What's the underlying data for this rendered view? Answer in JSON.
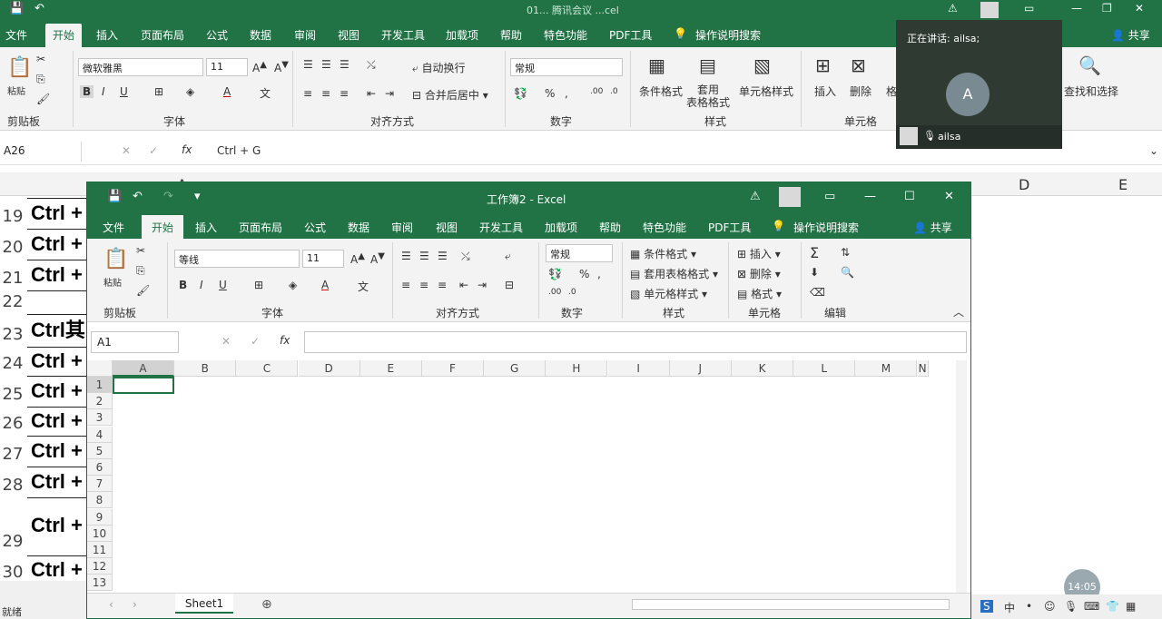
{
  "outer": {
    "title": "01... 腾讯会议 ...cel",
    "tabs": [
      "文件",
      "开始",
      "插入",
      "页面布局",
      "公式",
      "数据",
      "审阅",
      "视图",
      "开发工具",
      "加载项",
      "帮助",
      "特色功能",
      "PDF工具",
      "操作说明搜索"
    ],
    "share": "共享",
    "font_name": "微软雅黑",
    "font_size": "11",
    "number_format": "常规",
    "wrap_text": "自动换行",
    "merge_center": "合并后居中",
    "cond_format": "条件格式",
    "table_format": "套用\n表格格式",
    "cell_style": "单元格样式",
    "insert": "插入",
    "delete": "删除",
    "format_partial": "格",
    "find_select": "查找和选择",
    "paste": "粘贴",
    "groups": [
      "剪贴板",
      "字体",
      "对齐方式",
      "数字",
      "样式",
      "单元格"
    ],
    "namebox": "A26",
    "formula": "Ctrl + G",
    "columns": [
      "A",
      "D",
      "E"
    ],
    "rows": [
      {
        "n": "19",
        "text": "Ctrl +"
      },
      {
        "n": "20",
        "text": "Ctrl +"
      },
      {
        "n": "21",
        "text": "Ctrl +"
      },
      {
        "n": "22",
        "text": ""
      },
      {
        "n": "23",
        "text": "Ctrl其"
      },
      {
        "n": "24",
        "text": "Ctrl +"
      },
      {
        "n": "25",
        "text": "Ctrl +"
      },
      {
        "n": "26",
        "text": "Ctrl +"
      },
      {
        "n": "27",
        "text": "Ctrl +"
      },
      {
        "n": "28",
        "text": "Ctrl +"
      },
      {
        "n": "29",
        "text": "Ctrl +"
      },
      {
        "n": "30",
        "text": "Ctrl +"
      }
    ],
    "status": "就绪"
  },
  "meeting": {
    "speaking": "正在讲话: ailsa;",
    "avatar_letter": "A",
    "user": "ailsa"
  },
  "inner": {
    "title": "工作簿2 - Excel",
    "tabs": [
      "文件",
      "开始",
      "插入",
      "页面布局",
      "公式",
      "数据",
      "审阅",
      "视图",
      "开发工具",
      "加载项",
      "帮助",
      "特色功能",
      "PDF工具",
      "操作说明搜索"
    ],
    "share": "共享",
    "paste": "粘贴",
    "font_name": "等线",
    "font_size": "11",
    "number_format": "常规",
    "cond_format": "条件格式",
    "table_format": "套用表格格式",
    "cell_style": "单元格样式",
    "insert": "插入",
    "delete": "删除",
    "format": "格式",
    "groups": [
      "剪贴板",
      "字体",
      "对齐方式",
      "数字",
      "样式",
      "单元格",
      "编辑"
    ],
    "namebox": "A1",
    "columns": [
      "A",
      "B",
      "C",
      "D",
      "E",
      "F",
      "G",
      "H",
      "I",
      "J",
      "K",
      "L",
      "M",
      "N"
    ],
    "rows": [
      "1",
      "2",
      "3",
      "4",
      "5",
      "6",
      "7",
      "8",
      "9",
      "10",
      "11",
      "12",
      "13"
    ],
    "sheet": "Sheet1"
  },
  "clock": "14:05",
  "ime": "中"
}
